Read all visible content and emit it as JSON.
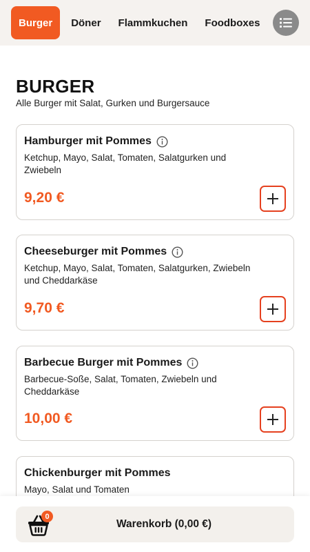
{
  "nav": {
    "categories": [
      {
        "label": "Burger",
        "active": true
      },
      {
        "label": "Döner",
        "active": false
      },
      {
        "label": "Flammkuchen",
        "active": false
      },
      {
        "label": "Foodboxes",
        "active": false
      }
    ],
    "menu_icon": "list-icon"
  },
  "section": {
    "title": "BURGER",
    "subtitle": "Alle Burger mit Salat, Gurken und Burgersauce"
  },
  "products": [
    {
      "name": "Hamburger mit Pommes",
      "info": true,
      "description": "Ketchup, Mayo, Salat, Tomaten, Salatgurken und Zwiebeln",
      "price": "9,20 €"
    },
    {
      "name": "Cheeseburger mit Pommes",
      "info": true,
      "description": "Ketchup, Mayo, Salat, Tomaten, Salatgurken, Zwiebeln und Cheddarkäse",
      "price": "9,70 €"
    },
    {
      "name": "Barbecue Burger mit Pommes",
      "info": true,
      "description": "Barbecue-Soße, Salat, Tomaten, Zwiebeln und Cheddarkäse",
      "price": "10,00 €"
    },
    {
      "name": "Chickenburger mit Pommes",
      "info": false,
      "description": "Mayo, Salat und Tomaten",
      "price": ""
    }
  ],
  "cart": {
    "count": "0",
    "label": "Warenkorb (0,00 €)"
  },
  "colors": {
    "accent": "#f15a22",
    "nav_background": "#f5f2ef",
    "button_border": "#e5401e",
    "cart_bar": "#f3f0ec"
  }
}
